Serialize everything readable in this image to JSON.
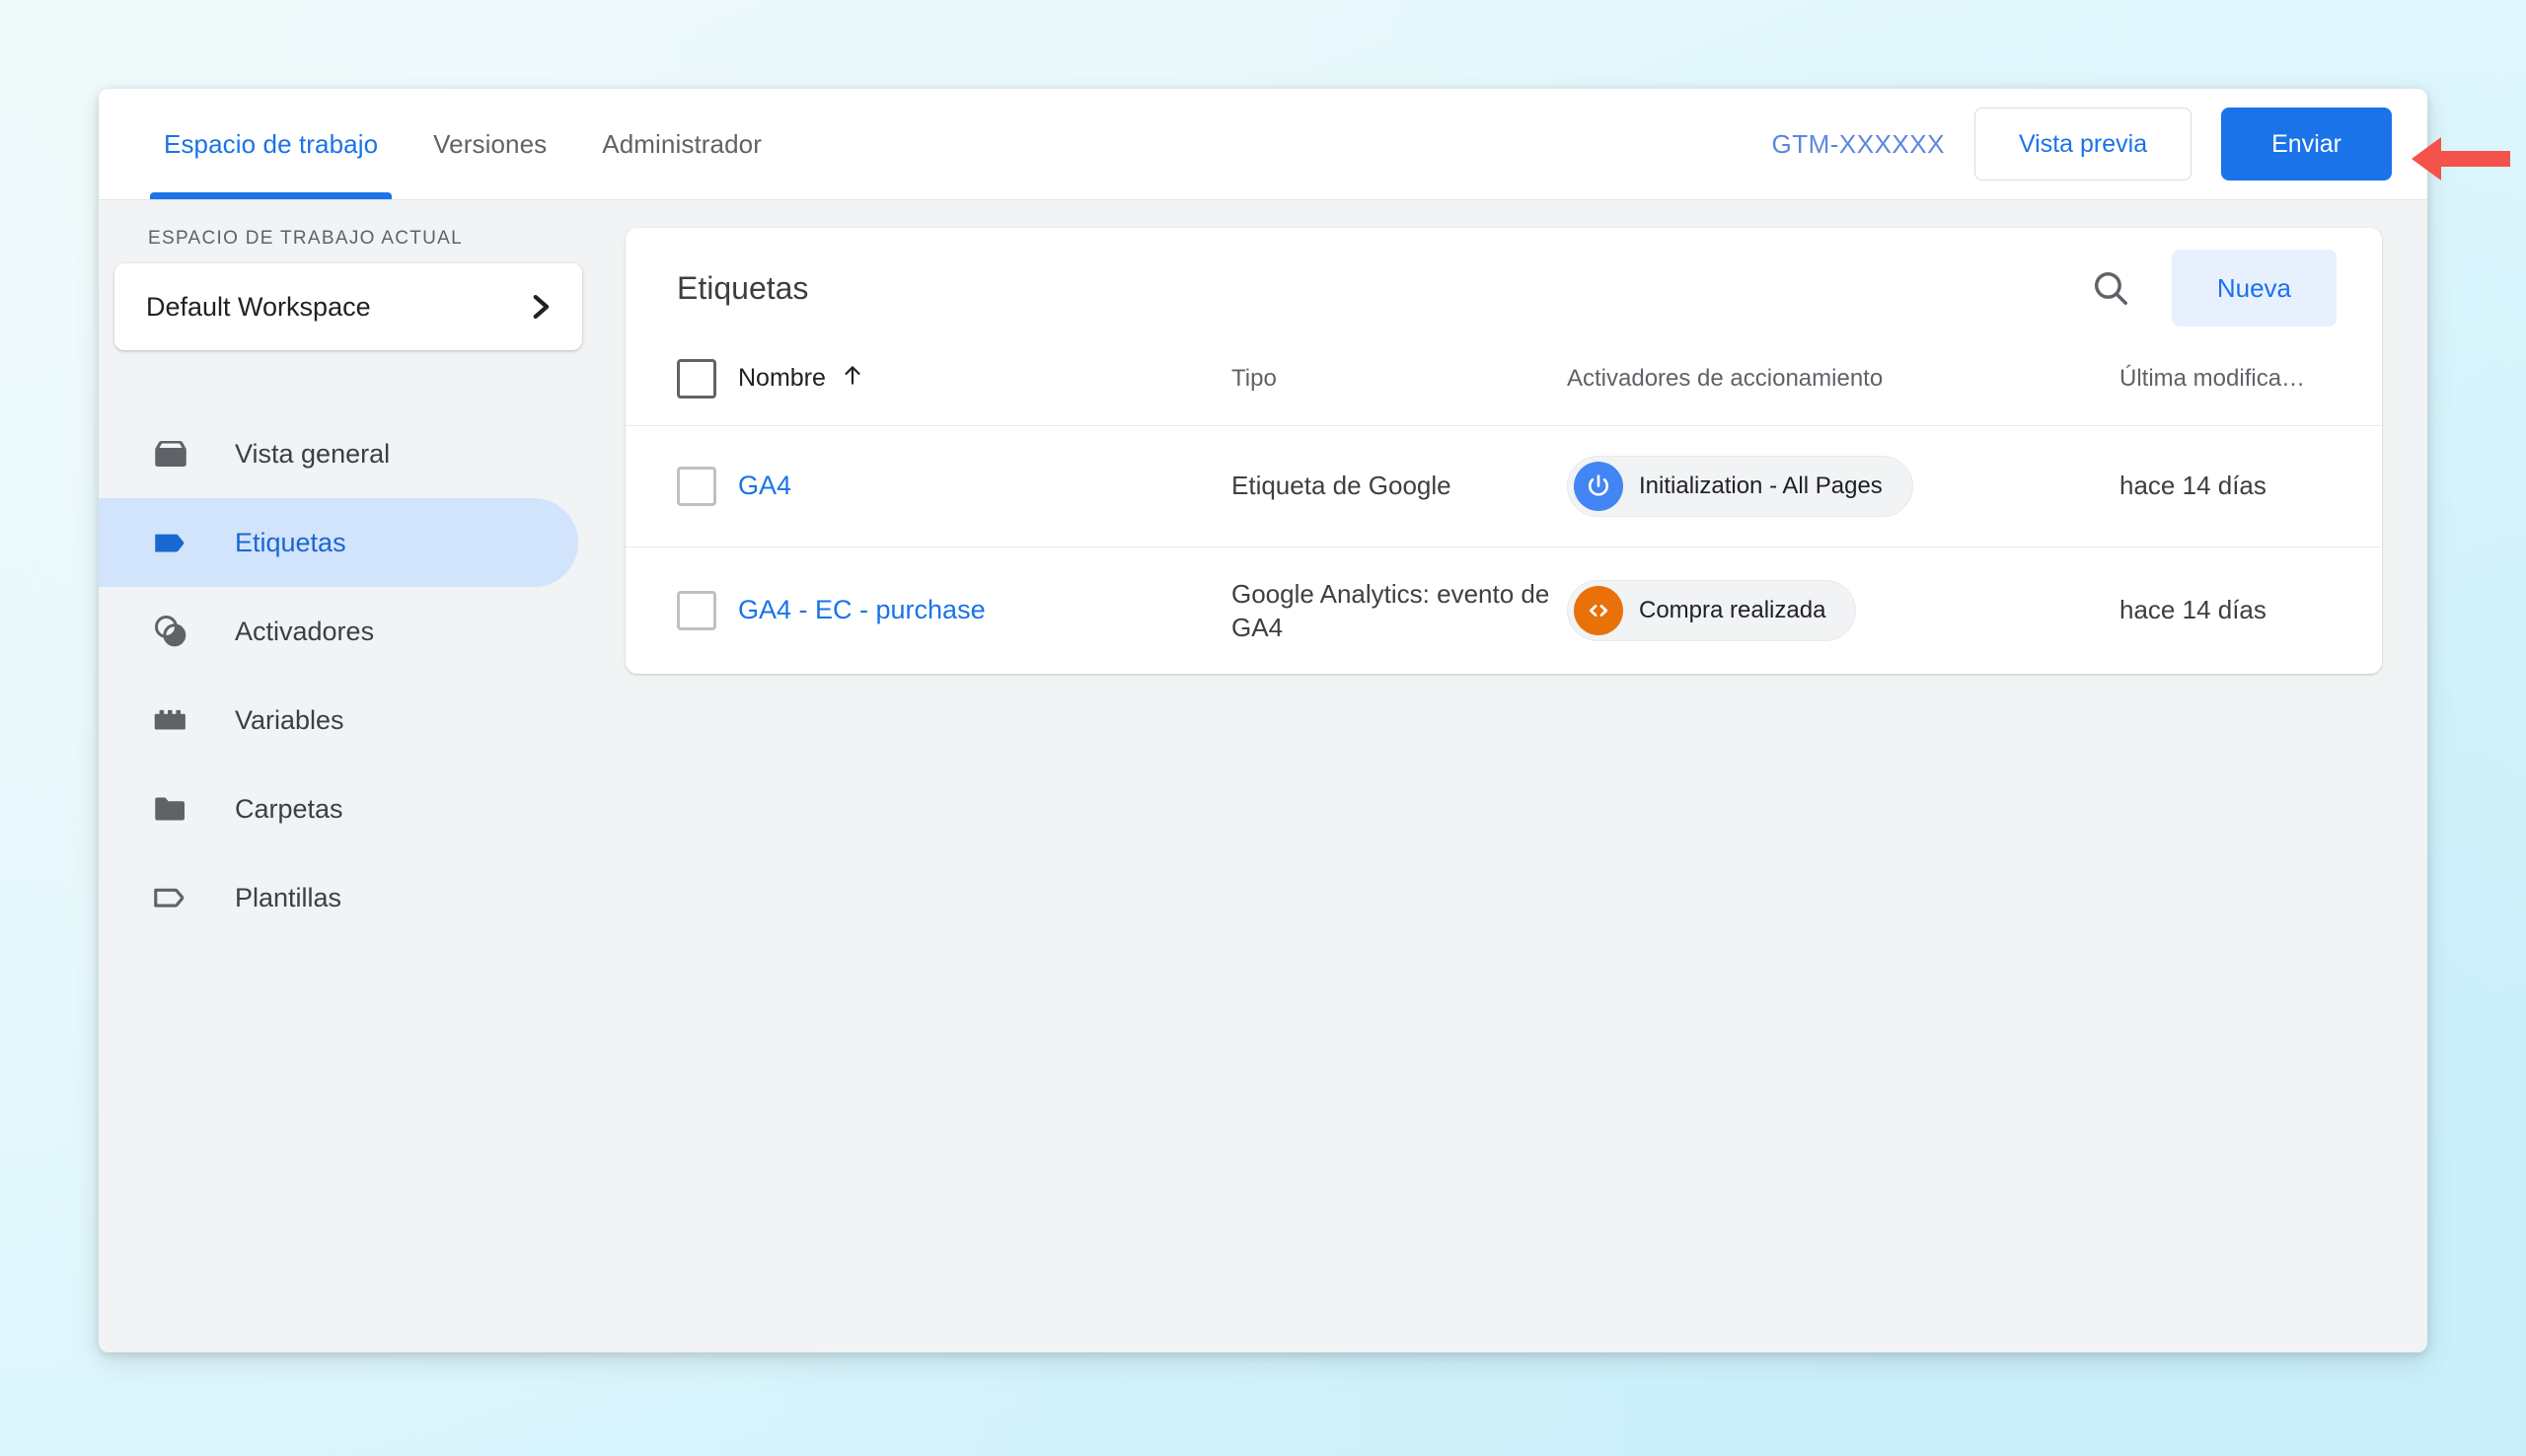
{
  "colors": {
    "accent_blue": "#1A73E8",
    "accent_blue_dark": "#1967D2",
    "nav_active_bg": "#D2E3FC",
    "new_button_bg": "#E8F0FE",
    "page_bg": "#DEF6FC",
    "surface_gray": "#F1F3F4",
    "trigger_blue": "#4285F4",
    "trigger_orange": "#E8710A",
    "annotation_red": "#F4524A"
  },
  "topbar": {
    "tabs": [
      {
        "label": "Espacio de trabajo",
        "active": true
      },
      {
        "label": "Versiones",
        "active": false
      },
      {
        "label": "Administrador",
        "active": false
      }
    ],
    "container_id": "GTM-XXXXXX",
    "preview_label": "Vista previa",
    "submit_label": "Enviar"
  },
  "sidebar": {
    "workspace_section_label": "ESPACIO DE TRABAJO ACTUAL",
    "workspace_name": "Default Workspace",
    "workspace_chevron_icon": "chevron-right-icon",
    "items": [
      {
        "label": "Vista general",
        "icon": "overview-box-icon",
        "active": false
      },
      {
        "label": "Etiquetas",
        "icon": "tag-icon",
        "active": true
      },
      {
        "label": "Activadores",
        "icon": "trigger-circles-icon",
        "active": false
      },
      {
        "label": "Variables",
        "icon": "variables-brick-icon",
        "active": false
      },
      {
        "label": "Carpetas",
        "icon": "folder-icon",
        "active": false
      },
      {
        "label": "Plantillas",
        "icon": "template-tag-icon",
        "active": false
      }
    ]
  },
  "main": {
    "card_title": "Etiquetas",
    "search_icon": "search-icon",
    "new_button_label": "Nueva",
    "table": {
      "select_all_checkbox": "unchecked",
      "columns": [
        {
          "key": "name",
          "label": "Nombre",
          "sort_icon": "arrow-up-icon",
          "sorted": true
        },
        {
          "key": "type",
          "label": "Tipo",
          "sorted": false
        },
        {
          "key": "trigger",
          "label": "Activadores de accionamiento",
          "sorted": false
        },
        {
          "key": "modified",
          "label": "Última modifica…",
          "sorted": false
        }
      ],
      "rows": [
        {
          "checkbox": "unchecked",
          "name": "GA4",
          "type": "Etiqueta de Google",
          "trigger": {
            "label": "Initialization - All Pages",
            "icon": "power-icon",
            "color": "#4285F4"
          },
          "modified": "hace 14 días"
        },
        {
          "checkbox": "unchecked",
          "name": "GA4 - EC - purchase",
          "type": "Google Analytics: evento de GA4",
          "trigger": {
            "label": "Compra realizada",
            "icon": "code-brackets-icon",
            "color": "#E8710A"
          },
          "modified": "hace 14 días"
        }
      ]
    }
  },
  "annotation": {
    "arrow_icon": "left-arrow-annotation",
    "points_to": "Enviar"
  }
}
